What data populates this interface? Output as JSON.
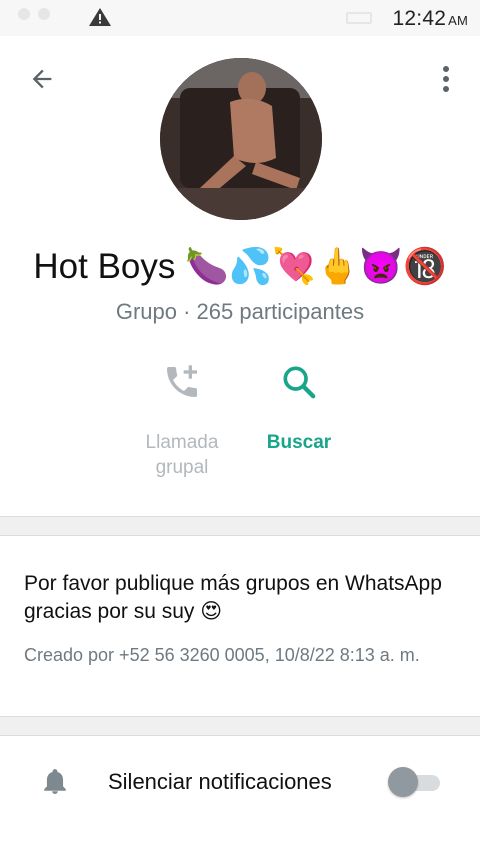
{
  "status_bar": {
    "time": "12:42",
    "ampm": "AM",
    "icons": [
      "signal-dot-icon",
      "signal-dot-icon",
      "warning-icon",
      "battery-icon"
    ]
  },
  "header": {
    "back_icon": "arrow-back-icon",
    "menu_icon": "more-vert-icon"
  },
  "group": {
    "name": "Hot Boys 🍆💦💘🖕👿🔞",
    "subtitle": "Grupo · 265 participantes"
  },
  "actions": {
    "call": {
      "label": "Llamada grupal",
      "icon": "add-call-icon",
      "enabled": false
    },
    "search": {
      "label": "Buscar",
      "icon": "search-icon",
      "enabled": true
    }
  },
  "description": {
    "text": "Por favor publique más grupos en WhatsApp gracias por su suy 😍",
    "created": "Creado por +52 56 3260 0005, 10/8/22 8:13 a. m."
  },
  "mute": {
    "label": "Silenciar notificaciones",
    "icon": "bell-icon",
    "on": false
  },
  "colors": {
    "accent": "#18a58a",
    "secondary_text": "#6f7a80",
    "disabled": "#b3b8bc",
    "divider_bg": "#f0f0f0"
  }
}
